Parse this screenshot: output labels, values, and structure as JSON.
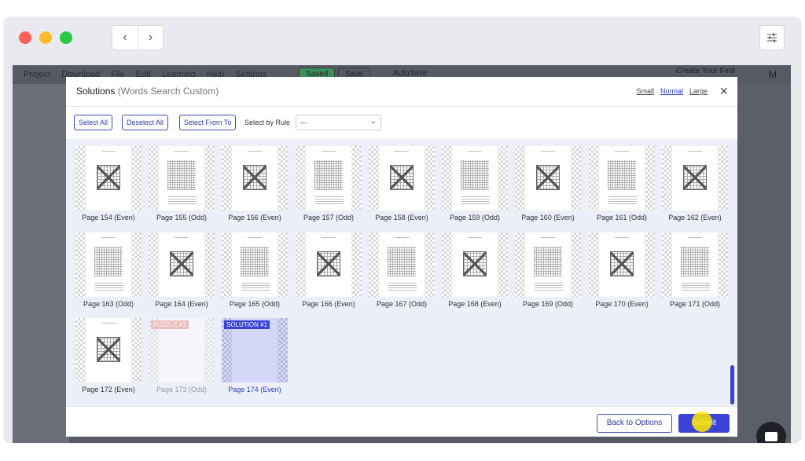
{
  "window": {
    "nav_back": "‹",
    "nav_forward": "›"
  },
  "background_app": {
    "menu": [
      "Project",
      "Download",
      "File",
      "Edit",
      "Learning",
      "Help",
      "Settings"
    ],
    "saved_label": "Saved",
    "save_button": "Save",
    "autosave_label": "AutoSave",
    "create_label": "Create Your First",
    "avatar": "M"
  },
  "modal": {
    "title": "Solutions",
    "subtitle": "(Words Search Custom)",
    "size_options": [
      "Small",
      "Normal",
      "Large"
    ],
    "active_size": "Normal",
    "close": "×",
    "toolbar": {
      "select_all": "Select All",
      "deselect_all": "Deselect All",
      "select_from_to": "Select From To",
      "select_by_rule_label": "Select by Rule",
      "select_by_rule_value": "---"
    },
    "pages": [
      {
        "label": "Page 154 (Even)",
        "kind": "solution"
      },
      {
        "label": "Page 155 (Odd)",
        "kind": "puzzle"
      },
      {
        "label": "Page 156 (Even)",
        "kind": "solution"
      },
      {
        "label": "Page 157 (Odd)",
        "kind": "puzzle"
      },
      {
        "label": "Page 158 (Even)",
        "kind": "solution"
      },
      {
        "label": "Page 159 (Odd)",
        "kind": "puzzle"
      },
      {
        "label": "Page 160 (Even)",
        "kind": "solution"
      },
      {
        "label": "Page 161 (Odd)",
        "kind": "puzzle"
      },
      {
        "label": "Page 162 (Even)",
        "kind": "solution"
      },
      {
        "label": "Page 163 (Odd)",
        "kind": "puzzle"
      },
      {
        "label": "Page 164 (Even)",
        "kind": "solution"
      },
      {
        "label": "Page 165 (Odd)",
        "kind": "puzzle"
      },
      {
        "label": "Page 166 (Even)",
        "kind": "solution"
      },
      {
        "label": "Page 167 (Odd)",
        "kind": "puzzle"
      },
      {
        "label": "Page 168 (Even)",
        "kind": "solution"
      },
      {
        "label": "Page 169 (Odd)",
        "kind": "puzzle"
      },
      {
        "label": "Page 170 (Even)",
        "kind": "solution"
      },
      {
        "label": "Page 171 (Odd)",
        "kind": "puzzle"
      },
      {
        "label": "Page 172 (Even)",
        "kind": "solution"
      },
      {
        "label": "Page 173 (Odd)",
        "kind": "blank-puzzle",
        "tag": "PUZZLE #1"
      },
      {
        "label": "Page 174 (Even)",
        "kind": "blank-solution",
        "tag": "SOLUTION #1"
      }
    ],
    "footer": {
      "back_button": "Back to Options",
      "submit_button": "Submit"
    }
  },
  "colors": {
    "accent": "#3b43d6",
    "puzzle_tag": "#f08f84",
    "solution_tag": "#3b43d6"
  }
}
